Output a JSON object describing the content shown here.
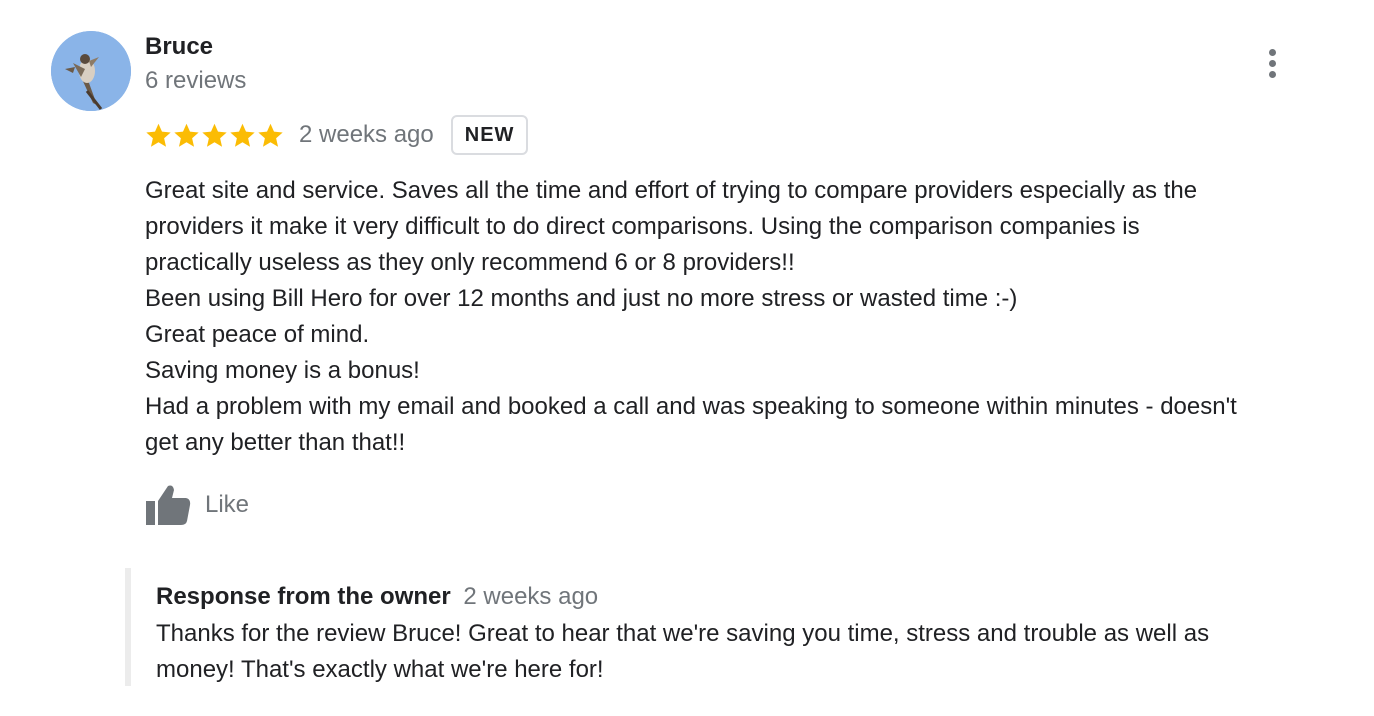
{
  "reviewer": {
    "name": "Bruce",
    "meta": "6 reviews"
  },
  "review": {
    "rating": 5,
    "max_rating": 5,
    "date": "2 weeks ago",
    "badge": "NEW",
    "text_lines": [
      "Great site and service. Saves all the time and effort of trying to compare providers especially as the",
      "providers it make it very difficult to do direct comparisons. Using the comparison companies is",
      "practically useless as they only recommend 6 or 8 providers!!",
      "Been using Bill Hero for over 12 months and just no more stress or wasted time :-)",
      "Great peace of mind.",
      "Saving money is a bonus!",
      "Had a problem with my email and booked a call and was speaking to someone within minutes - doesn't",
      "get any better than that!!"
    ]
  },
  "actions": {
    "like_label": "Like",
    "like_icon": "thumbs-up-icon",
    "more_icon": "more-vert-icon"
  },
  "owner_response": {
    "title": "Response from the owner",
    "date": "2 weeks ago",
    "text_lines": [
      "Thanks for the review Bruce! Great to hear that we're saving you time, stress and trouble as well as",
      "money! That's exactly what we're here for!"
    ]
  },
  "colors": {
    "star": "#fbbc04",
    "secondary_text": "#70757a",
    "primary_text": "#202124",
    "avatar_bg": "#8ab4e8",
    "response_border": "#ececec"
  }
}
